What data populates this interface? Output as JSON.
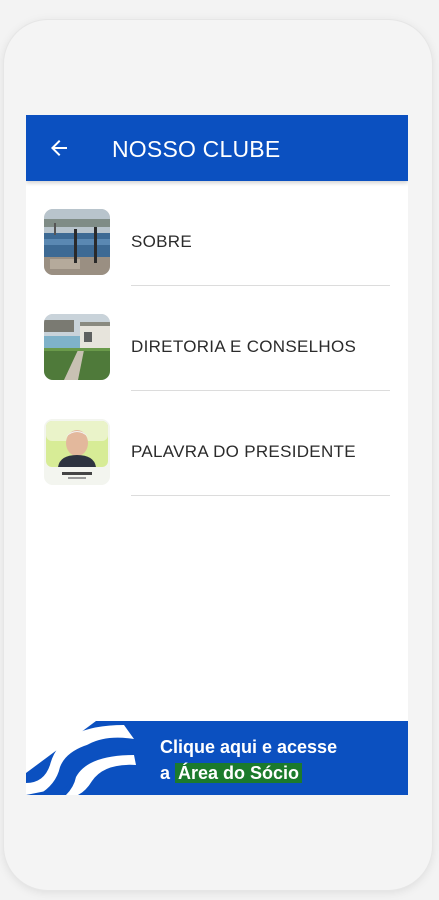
{
  "header": {
    "title": "NOSSO CLUBE",
    "back_icon": "arrow-left-icon"
  },
  "menu": {
    "items": [
      {
        "label": "SOBRE",
        "thumbnail": "pool-photo"
      },
      {
        "label": "DIRETORIA E CONSELHOS",
        "thumbnail": "clubhouse-photo"
      },
      {
        "label": "PALAVRA DO PRESIDENTE",
        "thumbnail": "president-portrait"
      }
    ]
  },
  "banner": {
    "line1": "Clique aqui e acesse",
    "line2_prefix": "a ",
    "line2_highlight": "Área do Sócio"
  },
  "colors": {
    "primary": "#0b50c0",
    "highlight": "#1b7a2c",
    "background": "#ffffff"
  }
}
